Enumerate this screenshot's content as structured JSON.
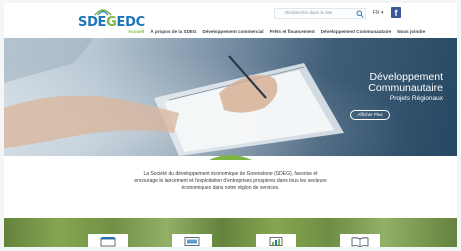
{
  "header": {
    "logo_text_part1": "SDE",
    "logo_text_part2": "G",
    "logo_text_part3": "EDC",
    "search_placeholder": "Rechercher dans le site",
    "language": "FR ▾",
    "facebook_letter": "f"
  },
  "nav": [
    {
      "label": "Accueil",
      "active": true
    },
    {
      "label": "À propos de la SDEG",
      "active": false
    },
    {
      "label": "Développement commercial",
      "active": false
    },
    {
      "label": "Prêts et financement",
      "active": false
    },
    {
      "label": "Développement Communautaire",
      "active": false
    },
    {
      "label": "Nous joindre",
      "active": false
    }
  ],
  "hero": {
    "title_line1": "Développement",
    "title_line2": "Communautaire",
    "subtitle": "Projets Régionaux",
    "button_label": "Afficher Plus"
  },
  "intro": {
    "text": "La Société du développement économique de Greenstone (SDEG), favorise et encourage le lancement et l'exploitation d'entreprises prospères dans tous les secteurs économiques dans notre région de services."
  },
  "colors": {
    "brand_blue": "#1c76b6",
    "brand_green": "#7db544",
    "facebook": "#3b5998"
  },
  "icons": [
    "search-icon",
    "facebook-icon",
    "store-icon",
    "computer-icon",
    "chart-icon",
    "book-icon"
  ]
}
